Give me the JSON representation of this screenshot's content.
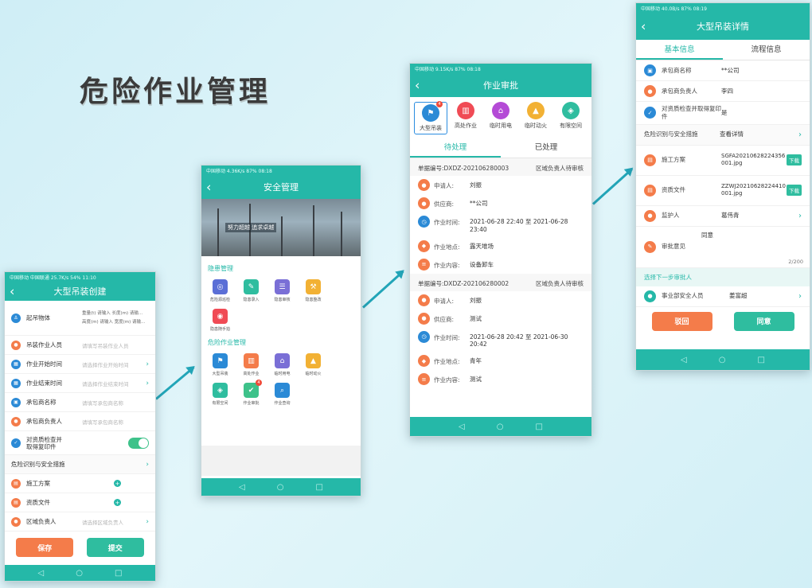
{
  "page_title": "危险作业管理",
  "colors": {
    "primary": "#25b8a8",
    "orange": "#f47c4a",
    "teal_btn": "#2fbd9f"
  },
  "phone1": {
    "status": "中国移动 中国联通 25.7K/s 54% 11:10",
    "title": "大型吊装创建",
    "rows": [
      {
        "icon": "hook-icon",
        "color": "#2b8ad6",
        "label": "起吊物体",
        "extra1": "重量(t) 请输入 长度(m) 请输...",
        "extra2": "高度(m) 请输入 宽度(m) 请输..."
      },
      {
        "icon": "person-icon",
        "color": "#f47c4a",
        "label": "吊装作业人员",
        "placeholder": "请填写吊装作业人员"
      },
      {
        "icon": "calendar-icon",
        "color": "#2b8ad6",
        "label": "作业开始时间",
        "placeholder": "请选择作业开始时间"
      },
      {
        "icon": "calendar-icon",
        "color": "#2b8ad6",
        "label": "作业结束时间",
        "placeholder": "请选择作业结束时间"
      },
      {
        "icon": "building-icon",
        "color": "#2b8ad6",
        "label": "承包商名称",
        "placeholder": "请填写承包商名称"
      },
      {
        "icon": "person-icon",
        "color": "#f47c4a",
        "label": "承包商负责人",
        "placeholder": "请填写承包商名称"
      },
      {
        "icon": "doc-check-icon",
        "color": "#2b8ad6",
        "label": "对资质检查并取得复印件"
      }
    ],
    "risk_label": "危险识别与安全措施",
    "attach_rows": [
      {
        "icon": "doc-icon",
        "color": "#f47c4a",
        "label": "施工方案"
      },
      {
        "icon": "doc-icon",
        "color": "#f47c4a",
        "label": "资质文件"
      },
      {
        "icon": "person-icon",
        "color": "#f47c4a",
        "label": "区域负责人",
        "placeholder": "请选择区域负责人"
      }
    ],
    "save_label": "保存",
    "submit_label": "提交"
  },
  "phone2": {
    "status": "中国移动 4.36K/s 87% 08:18",
    "title": "安全管理",
    "banner_slogan": "努力超越 追求卓越",
    "section1": "隐患管理",
    "grid1": [
      {
        "icon": "radar-icon",
        "color": "#5b6fd6",
        "label": "危险源巡检"
      },
      {
        "icon": "edit-icon",
        "color": "#2fbd9f",
        "label": "隐患录入"
      },
      {
        "icon": "review-icon",
        "color": "#7a6fd6",
        "label": "隐患审核"
      },
      {
        "icon": "rectify-icon",
        "color": "#f2b134",
        "label": "隐患整改"
      },
      {
        "icon": "camera-icon",
        "color": "#f04b55",
        "label": "隐患随手拍"
      }
    ],
    "section2": "危险作业管理",
    "grid2": [
      {
        "icon": "crane-icon",
        "color": "#2b8ad6",
        "label": "大型吊装"
      },
      {
        "icon": "ladder-icon",
        "color": "#f47c4a",
        "label": "高处作业"
      },
      {
        "icon": "power-icon",
        "color": "#7a6fd6",
        "label": "临时用电"
      },
      {
        "icon": "fire-icon",
        "color": "#f2b134",
        "label": "临时动火"
      },
      {
        "icon": "space-icon",
        "color": "#2fbd9f",
        "label": "有限空间"
      },
      {
        "icon": "approve-icon",
        "color": "#3ec28a",
        "label": "作业审批",
        "badge": "4"
      },
      {
        "icon": "query-icon",
        "color": "#2b8ad6",
        "label": "作业查询"
      }
    ]
  },
  "phone3": {
    "status": "中国移动 9.15K/s 87% 08:18",
    "title": "作业审批",
    "categories": [
      {
        "icon": "crane-icon",
        "color": "#2b8ad6",
        "label": "大型吊装",
        "badge": "4",
        "selected": true
      },
      {
        "icon": "ladder-icon",
        "color": "#f04b55",
        "label": "高处作业"
      },
      {
        "icon": "power-icon",
        "color": "#b44bd6",
        "label": "临时用电"
      },
      {
        "icon": "fire-icon",
        "color": "#f2b134",
        "label": "临时动火"
      },
      {
        "icon": "space-icon",
        "color": "#2fbd9f",
        "label": "有限空间"
      }
    ],
    "tab_pending": "待处理",
    "tab_done": "已处理",
    "bills": [
      {
        "no": "单据编号:DXDZ-202106280003",
        "status": "区域负责人待审核",
        "fields": [
          {
            "icon": "person-icon",
            "color": "#f47c4a",
            "label": "申请人:",
            "value": "刘振"
          },
          {
            "icon": "person-icon",
            "color": "#f47c4a",
            "label": "供应商:",
            "value": "**公司"
          },
          {
            "icon": "clock-icon",
            "color": "#2b8ad6",
            "label": "作业时间:",
            "value": "2021-06-28 22:40 至 2021-06-28 23:40"
          },
          {
            "icon": "pin-icon",
            "color": "#f47c4a",
            "label": "作业地点:",
            "value": "露天堆场"
          },
          {
            "icon": "list-icon",
            "color": "#f47c4a",
            "label": "作业内容:",
            "value": "设备卸车"
          }
        ]
      },
      {
        "no": "单据编号:DXDZ-202106280002",
        "status": "区域负责人待审核",
        "fields": [
          {
            "icon": "person-icon",
            "color": "#f47c4a",
            "label": "申请人:",
            "value": "刘振"
          },
          {
            "icon": "person-icon",
            "color": "#f47c4a",
            "label": "供应商:",
            "value": "测试"
          },
          {
            "icon": "clock-icon",
            "color": "#2b8ad6",
            "label": "作业时间:",
            "value": "2021-06-28 20:42 至 2021-06-30 20:42"
          },
          {
            "icon": "pin-icon",
            "color": "#f47c4a",
            "label": "作业地点:",
            "value": "青年"
          },
          {
            "icon": "list-icon",
            "color": "#f47c4a",
            "label": "作业内容:",
            "value": "测试"
          }
        ]
      }
    ]
  },
  "phone4": {
    "status": "中国移动 40.0B/s 87% 08:19",
    "title": "大型吊装详情",
    "tab_basic": "基本信息",
    "tab_flow": "流程信息",
    "rows": [
      {
        "icon": "building-icon",
        "color": "#2b8ad6",
        "label": "承包商名称",
        "value": "**公司"
      },
      {
        "icon": "person-icon",
        "color": "#f47c4a",
        "label": "承包商负责人",
        "value": "李四"
      },
      {
        "icon": "doc-check-icon",
        "color": "#2b8ad6",
        "label": "对资质检查并取得复印件",
        "value": "是"
      }
    ],
    "risk_label": "危险识别与安全措施",
    "risk_value": "查看详情",
    "files": [
      {
        "icon": "doc-icon",
        "color": "#f47c4a",
        "label": "施工方案",
        "value": "SGFA20210628224356001.jpg",
        "btn": "下载"
      },
      {
        "icon": "doc-icon",
        "color": "#f47c4a",
        "label": "资质文件",
        "value": "ZZWJ20210628224410001.jpg",
        "btn": "下载"
      }
    ],
    "guardian_label": "监护人",
    "guardian_value": "葛伟青",
    "opinion_label": "审批意见",
    "opinion_value": "同意",
    "opinion_count": "2/200",
    "next_label": "选择下一步审批人",
    "approver_label": "事业部安全人员",
    "approver_value": "姜富超",
    "reject_label": "驳回",
    "agree_label": "同意"
  }
}
